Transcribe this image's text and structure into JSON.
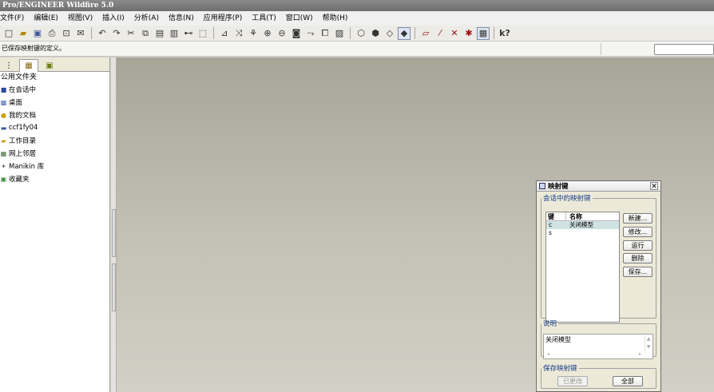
{
  "app": {
    "title": "Pro/ENGINEER Wildfire 5.0"
  },
  "menu": [
    "文件(F)",
    "编辑(E)",
    "视图(V)",
    "插入(I)",
    "分析(A)",
    "信息(N)",
    "应用程序(P)",
    "工具(T)",
    "窗口(W)",
    "帮助(H)"
  ],
  "toolbar": {
    "groups": [
      [
        "new-file",
        "open-file",
        "save",
        "print",
        "print-preview",
        "send-email"
      ],
      [
        "undo",
        "redo",
        "cut",
        "copy",
        "paste",
        "paste-special",
        "find",
        "select-box"
      ],
      [
        "redraw",
        "spin-center",
        "orient",
        "zoom-in",
        "zoom-out",
        "refit",
        "reorient",
        "saved-views",
        "view-manager"
      ],
      [
        "wireframe",
        "hidden-line",
        "no-hidden",
        "shading"
      ],
      [
        "datum-planes",
        "datum-axes",
        "datum-points",
        "coordinate-systems",
        "annotations"
      ],
      [
        "context-help"
      ]
    ]
  },
  "message_area": {
    "text": "已保存映射键的定义。"
  },
  "navigator": {
    "tabs": [
      "model-tree-tab",
      "folder-browser-tab",
      "favorites-tab"
    ],
    "section_title": "公用文件夹",
    "items": [
      {
        "label": "在会话中",
        "icon": "session-icon"
      },
      {
        "label": "桌面",
        "icon": "desktop-icon"
      },
      {
        "label": "我的文档",
        "icon": "documents-icon"
      },
      {
        "label": "ccf1fy04",
        "icon": "computer-icon"
      },
      {
        "label": "工作目录",
        "icon": "working-directory-icon"
      },
      {
        "label": "网上邻居",
        "icon": "network-icon"
      },
      {
        "label": "Manikin 库",
        "icon": "manikin-icon"
      },
      {
        "label": "收藏夹",
        "icon": "favorites-icon"
      }
    ]
  },
  "mapkeys_dialog": {
    "title": "映射键",
    "session_group": "会话中的映射键",
    "columns": {
      "key": "键",
      "name": "名称"
    },
    "rows": [
      {
        "key": "c",
        "name": "关闭模型",
        "selected": true
      },
      {
        "key": "s",
        "name": "",
        "selected": false
      }
    ],
    "buttons": {
      "new": "新建...",
      "modify": "修改...",
      "run": "运行",
      "delete": "删除",
      "save": "保存..."
    },
    "description_group": "说明",
    "description": "关闭模型",
    "save_group": "保存映射键",
    "save_buttons": {
      "changed": "已更改",
      "all": "全部"
    }
  }
}
